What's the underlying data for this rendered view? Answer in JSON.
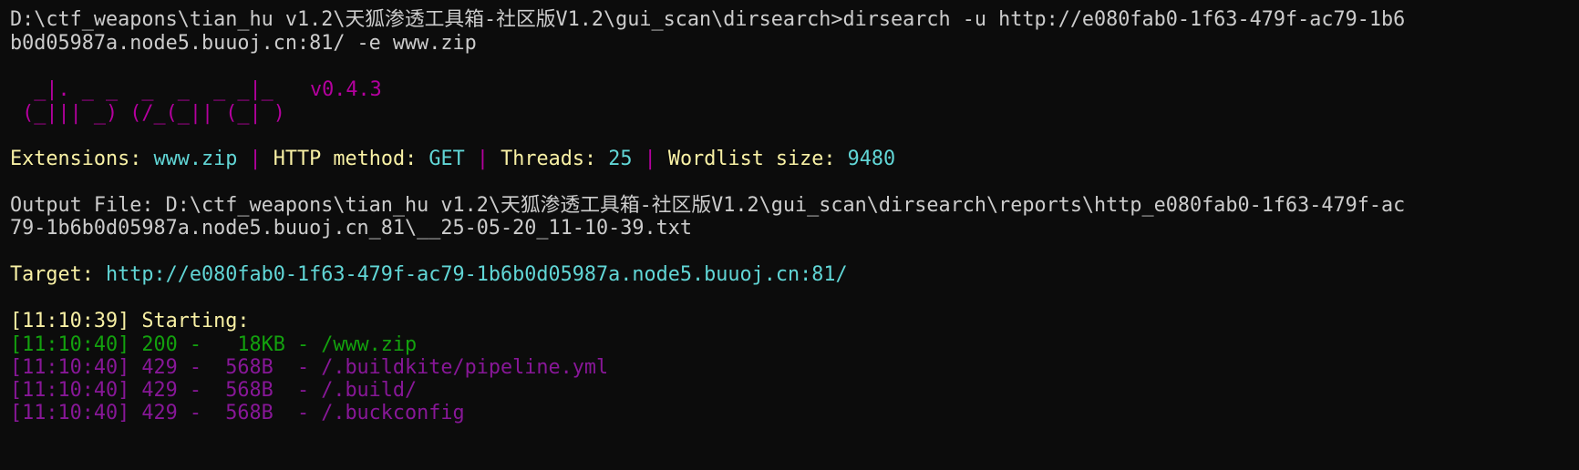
{
  "colors": {
    "background": "#0c0c0c",
    "default_text": "#cccccc",
    "banner_magenta": "#b4009e",
    "info_yellow": "#f9f1a5",
    "info_cyan": "#61d6d6",
    "separator_magenta": "#b4009e",
    "status_200_green": "#13a10e",
    "status_429_purple": "#881798"
  },
  "command": {
    "line1": "D:\\ctf_weapons\\tian_hu v1.2\\天狐渗透工具箱-社区版V1.2\\gui_scan\\dirsearch>dirsearch -u http://e080fab0-1f63-479f-ac79-1b6",
    "line2": "b0d05987a.node5.buuoj.cn:81/ -e www.zip"
  },
  "banner": {
    "art_line1": "  _|. _ _  _  _  _ _|_",
    "art_line2": " (_||| _) (/_(_|| (_| )",
    "version": "v0.4.3"
  },
  "info": {
    "extensions_label": "Extensions: ",
    "extensions_value": "www.zip",
    "sep": " | ",
    "method_label": "HTTP method: ",
    "method_value": "GET",
    "threads_label": "Threads: ",
    "threads_value": "25",
    "wordlist_label": "Wordlist size: ",
    "wordlist_value": "9480"
  },
  "output": {
    "line1": "Output File: D:\\ctf_weapons\\tian_hu v1.2\\天狐渗透工具箱-社区版V1.2\\gui_scan\\dirsearch\\reports\\http_e080fab0-1f63-479f-ac",
    "line2": "79-1b6b0d05987a.node5.buuoj.cn_81\\__25-05-20_11-10-39.txt"
  },
  "target": {
    "label": "Target: ",
    "url": "http://e080fab0-1f63-479f-ac79-1b6b0d05987a.node5.buuoj.cn:81/"
  },
  "start": {
    "text": "[11:10:39] Starting: "
  },
  "results": [
    {
      "text": "[11:10:40] 200 -   18KB - /www.zip",
      "status": "200"
    },
    {
      "text": "[11:10:40] 429 -  568B  - /.buildkite/pipeline.yml",
      "status": "429"
    },
    {
      "text": "[11:10:40] 429 -  568B  - /.build/",
      "status": "429"
    },
    {
      "text": "[11:10:40] 429 -  568B  - /.buckconfig",
      "status": "429"
    }
  ]
}
